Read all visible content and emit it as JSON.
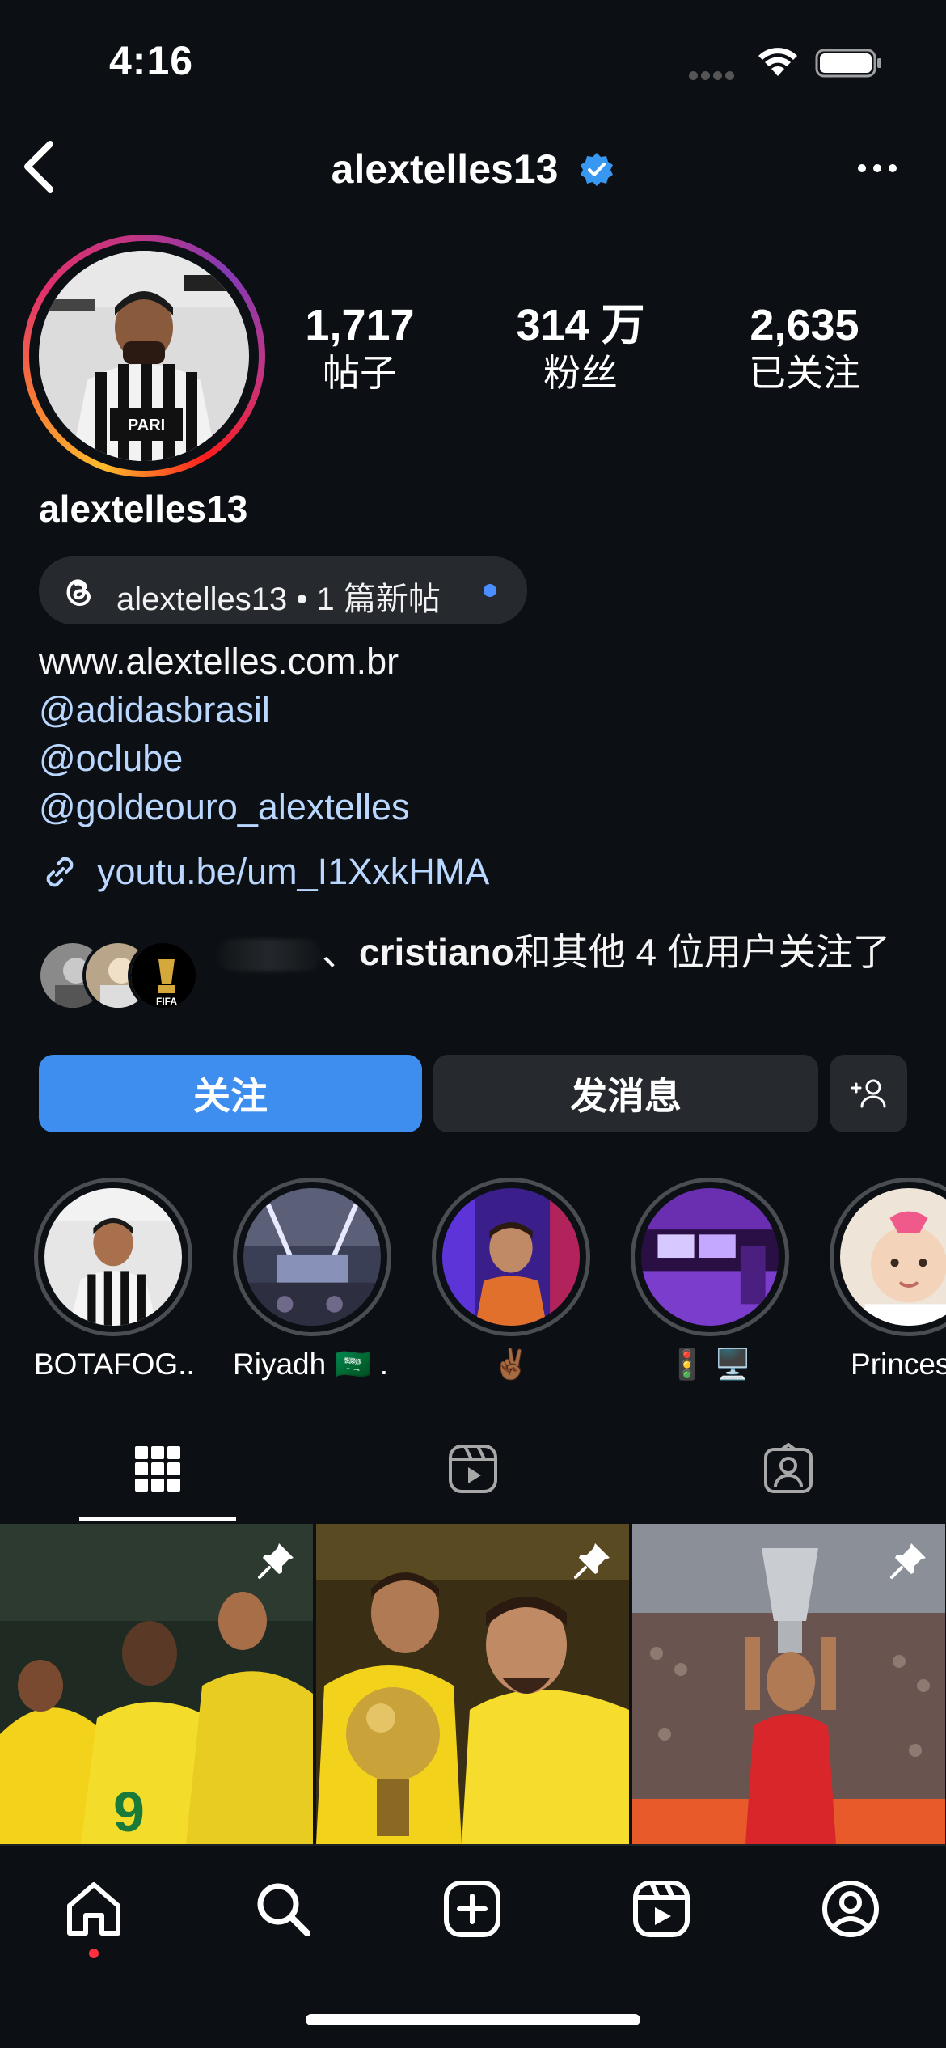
{
  "status_bar": {
    "time": "4:16"
  },
  "header": {
    "username": "alextelles13",
    "verified": true
  },
  "profile": {
    "stats": [
      {
        "value": "1,717",
        "label": "帖子"
      },
      {
        "value": "314 万",
        "label": "粉丝"
      },
      {
        "value": "2,635",
        "label": "已关注"
      }
    ],
    "name": "alextelles13",
    "threads_badge": "alextelles13 • 1 篇新帖",
    "bio": {
      "website": "www.alextelles.com.br",
      "mentions": [
        "@adidasbrasil",
        "@oclube",
        "@goldeouro_alextelles"
      ],
      "link": "youtu.be/um_I1XxkHMA"
    },
    "mutual": {
      "separator": "、",
      "highlight_name": "cristiano",
      "suffix": "和其他 4 位用户关注了"
    }
  },
  "actions": {
    "follow": "关注",
    "message": "发消息"
  },
  "highlights": [
    {
      "label": "BOTAFOG..."
    },
    {
      "label": "Riyadh 🇸🇦 ..."
    },
    {
      "label": "✌🏾"
    },
    {
      "label": "🚦 🖥️"
    },
    {
      "label": "Princesa"
    }
  ],
  "colors": {
    "background": "#0c1014",
    "accent_blue": "#3e8ef0",
    "button_gray": "#262a2f",
    "link_blue": "#b9d7ff",
    "notification_red": "#ff3040"
  }
}
